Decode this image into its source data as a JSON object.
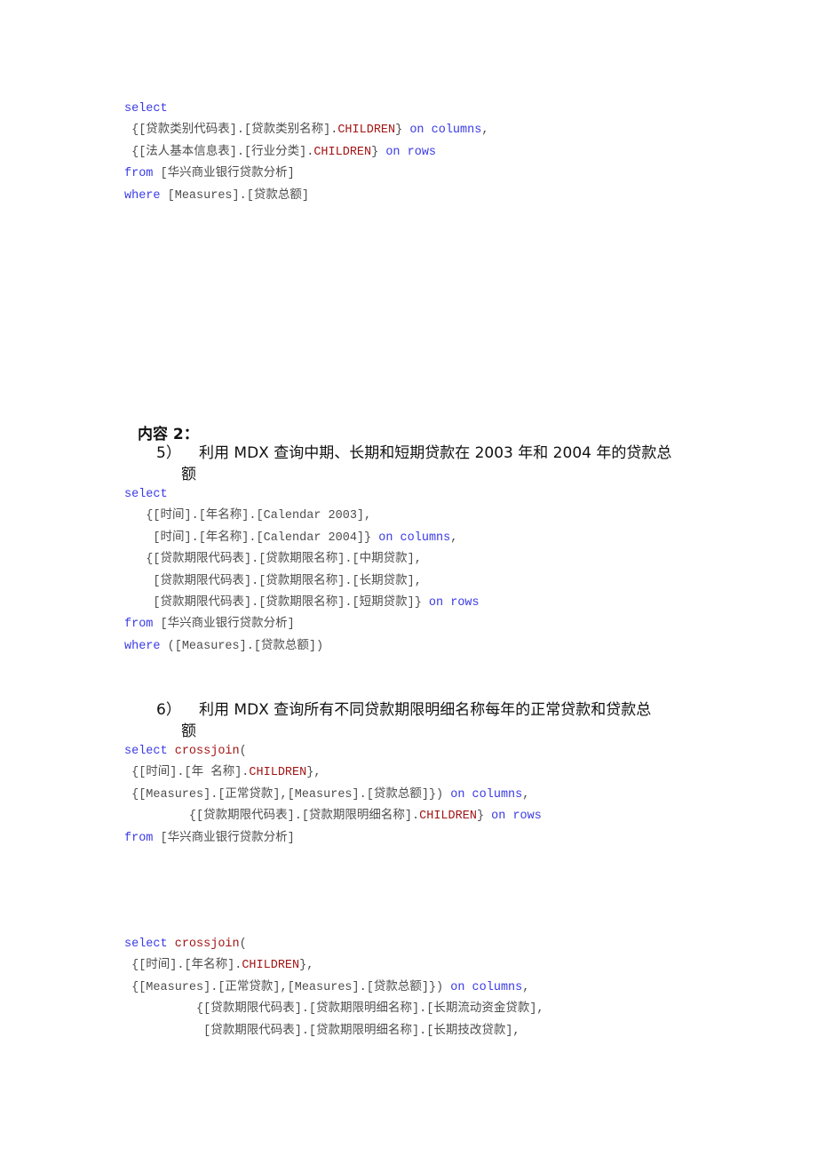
{
  "colors": {
    "keyword": "#3a3ae6",
    "function": "#a31515",
    "text": "#4d4d4d"
  },
  "block1": {
    "lines": [
      [
        {
          "t": "kw",
          "v": "select"
        }
      ],
      [
        {
          "t": "txt",
          "v": " {[贷款类别代码表].[贷款类别名称]."
        },
        {
          "t": "fn",
          "v": "CHILDREN"
        },
        {
          "t": "txt",
          "v": "} "
        },
        {
          "t": "kw",
          "v": "on columns"
        },
        {
          "t": "txt",
          "v": ","
        }
      ],
      [
        {
          "t": "txt",
          "v": " {[法人基本信息表].[行业分类]."
        },
        {
          "t": "fn",
          "v": "CHILDREN"
        },
        {
          "t": "txt",
          "v": "} "
        },
        {
          "t": "kw",
          "v": "on rows"
        }
      ],
      [
        {
          "t": "kw",
          "v": "from"
        },
        {
          "t": "txt",
          "v": " [华兴商业银行贷款分析]"
        }
      ],
      [
        {
          "t": "kw",
          "v": "where"
        },
        {
          "t": "txt",
          "v": " [Measures].[贷款总额]"
        }
      ]
    ]
  },
  "section2": {
    "heading": "内容 2：",
    "item5": {
      "number": "5）",
      "text": "利用 MDX 查询中期、长期和短期贷款在 2003 年和 2004 年的贷款总",
      "continuation": "额"
    },
    "item6": {
      "number": "6）",
      "text": "利用 MDX 查询所有不同贷款期限明细名称每年的正常贷款和贷款总",
      "continuation": "额"
    }
  },
  "block2": {
    "lines": [
      [
        {
          "t": "kw",
          "v": "select"
        }
      ],
      [
        {
          "t": "txt",
          "v": "   {[时间].[年名称].[Calendar 2003],"
        }
      ],
      [
        {
          "t": "txt",
          "v": "    [时间].[年名称].[Calendar 2004]} "
        },
        {
          "t": "kw",
          "v": "on columns"
        },
        {
          "t": "txt",
          "v": ","
        }
      ],
      [
        {
          "t": "txt",
          "v": "   {[贷款期限代码表].[贷款期限名称].[中期贷款],"
        }
      ],
      [
        {
          "t": "txt",
          "v": "    [贷款期限代码表].[贷款期限名称].[长期贷款],"
        }
      ],
      [
        {
          "t": "txt",
          "v": "    [贷款期限代码表].[贷款期限名称].[短期贷款]} "
        },
        {
          "t": "kw",
          "v": "on rows"
        }
      ],
      [
        {
          "t": "kw",
          "v": "from"
        },
        {
          "t": "txt",
          "v": " [华兴商业银行贷款分析]"
        }
      ],
      [
        {
          "t": "kw",
          "v": "where"
        },
        {
          "t": "txt",
          "v": " ([Measures].[贷款总额])"
        }
      ]
    ]
  },
  "block3": {
    "lines": [
      [
        {
          "t": "kw",
          "v": "select"
        },
        {
          "t": "txt",
          "v": " "
        },
        {
          "t": "fn",
          "v": "crossjoin"
        },
        {
          "t": "txt",
          "v": "("
        }
      ],
      [
        {
          "t": "txt",
          "v": " {[时间].[年 名称]."
        },
        {
          "t": "fn",
          "v": "CHILDREN"
        },
        {
          "t": "txt",
          "v": "},"
        }
      ],
      [
        {
          "t": "txt",
          "v": " {[Measures].[正常贷款],[Measures].[贷款总额]}) "
        },
        {
          "t": "kw",
          "v": "on columns"
        },
        {
          "t": "txt",
          "v": ","
        }
      ],
      [
        {
          "t": "txt",
          "v": "         {[贷款期限代码表].[贷款期限明细名称]."
        },
        {
          "t": "fn",
          "v": "CHILDREN"
        },
        {
          "t": "txt",
          "v": "} "
        },
        {
          "t": "kw",
          "v": "on rows"
        }
      ],
      [
        {
          "t": "kw",
          "v": "from"
        },
        {
          "t": "txt",
          "v": " [华兴商业银行贷款分析]"
        }
      ]
    ]
  },
  "block4": {
    "lines": [
      [
        {
          "t": "kw",
          "v": "select"
        },
        {
          "t": "txt",
          "v": " "
        },
        {
          "t": "fn",
          "v": "crossjoin"
        },
        {
          "t": "txt",
          "v": "("
        }
      ],
      [
        {
          "t": "txt",
          "v": " {[时间].[年名称]."
        },
        {
          "t": "fn",
          "v": "CHILDREN"
        },
        {
          "t": "txt",
          "v": "},"
        }
      ],
      [
        {
          "t": "txt",
          "v": " {[Measures].[正常贷款],[Measures].[贷款总额]}) "
        },
        {
          "t": "kw",
          "v": "on columns"
        },
        {
          "t": "txt",
          "v": ","
        }
      ],
      [
        {
          "t": "txt",
          "v": "          {[贷款期限代码表].[贷款期限明细名称].[长期流动资金贷款],"
        }
      ],
      [
        {
          "t": "txt",
          "v": "           [贷款期限代码表].[贷款期限明细名称].[长期技改贷款],"
        }
      ]
    ]
  }
}
